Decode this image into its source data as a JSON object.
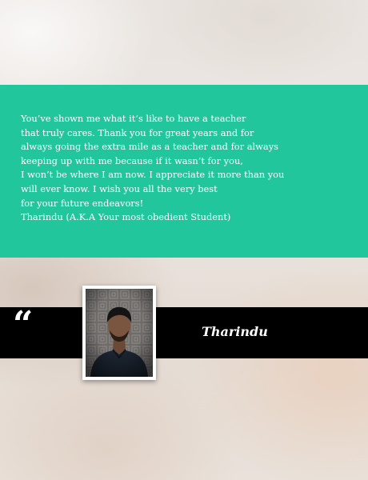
{
  "testimonial": {
    "message": "You’ve shown me what it’s like to have a teacher\nthat truly cares. Thank you for great years and for\nalways going the extra mile as a teacher and for always\nkeeping up with me because if it wasn’t for you,\nI won’t be where I am now. I appreciate it more than you\nwill ever know. I wish you all the very best\nfor your future endeavors!\nTharindu (A.K.A Your most obedient Student)"
  },
  "signature": {
    "quote_mark": "“",
    "name": "Tharindu"
  },
  "icons": {
    "quote": "quote-mark-icon",
    "portrait": "student-portrait"
  },
  "colors": {
    "panel": "#21c69c",
    "band": "#000000",
    "text": "#ffffff"
  }
}
